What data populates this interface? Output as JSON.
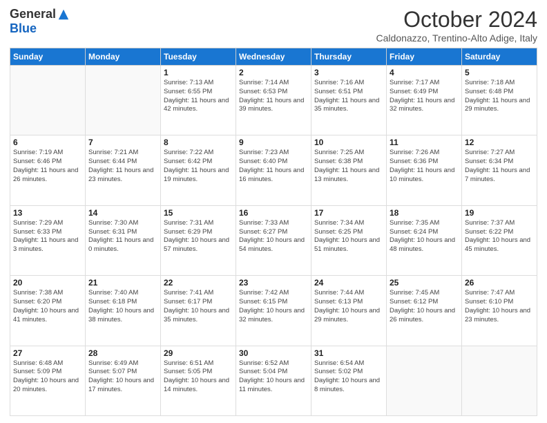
{
  "header": {
    "logo_general": "General",
    "logo_blue": "Blue",
    "month_title": "October 2024",
    "subtitle": "Caldonazzo, Trentino-Alto Adige, Italy"
  },
  "weekdays": [
    "Sunday",
    "Monday",
    "Tuesday",
    "Wednesday",
    "Thursday",
    "Friday",
    "Saturday"
  ],
  "weeks": [
    [
      {
        "day": "",
        "info": ""
      },
      {
        "day": "",
        "info": ""
      },
      {
        "day": "1",
        "info": "Sunrise: 7:13 AM\nSunset: 6:55 PM\nDaylight: 11 hours and 42 minutes."
      },
      {
        "day": "2",
        "info": "Sunrise: 7:14 AM\nSunset: 6:53 PM\nDaylight: 11 hours and 39 minutes."
      },
      {
        "day": "3",
        "info": "Sunrise: 7:16 AM\nSunset: 6:51 PM\nDaylight: 11 hours and 35 minutes."
      },
      {
        "day": "4",
        "info": "Sunrise: 7:17 AM\nSunset: 6:49 PM\nDaylight: 11 hours and 32 minutes."
      },
      {
        "day": "5",
        "info": "Sunrise: 7:18 AM\nSunset: 6:48 PM\nDaylight: 11 hours and 29 minutes."
      }
    ],
    [
      {
        "day": "6",
        "info": "Sunrise: 7:19 AM\nSunset: 6:46 PM\nDaylight: 11 hours and 26 minutes."
      },
      {
        "day": "7",
        "info": "Sunrise: 7:21 AM\nSunset: 6:44 PM\nDaylight: 11 hours and 23 minutes."
      },
      {
        "day": "8",
        "info": "Sunrise: 7:22 AM\nSunset: 6:42 PM\nDaylight: 11 hours and 19 minutes."
      },
      {
        "day": "9",
        "info": "Sunrise: 7:23 AM\nSunset: 6:40 PM\nDaylight: 11 hours and 16 minutes."
      },
      {
        "day": "10",
        "info": "Sunrise: 7:25 AM\nSunset: 6:38 PM\nDaylight: 11 hours and 13 minutes."
      },
      {
        "day": "11",
        "info": "Sunrise: 7:26 AM\nSunset: 6:36 PM\nDaylight: 11 hours and 10 minutes."
      },
      {
        "day": "12",
        "info": "Sunrise: 7:27 AM\nSunset: 6:34 PM\nDaylight: 11 hours and 7 minutes."
      }
    ],
    [
      {
        "day": "13",
        "info": "Sunrise: 7:29 AM\nSunset: 6:33 PM\nDaylight: 11 hours and 3 minutes."
      },
      {
        "day": "14",
        "info": "Sunrise: 7:30 AM\nSunset: 6:31 PM\nDaylight: 11 hours and 0 minutes."
      },
      {
        "day": "15",
        "info": "Sunrise: 7:31 AM\nSunset: 6:29 PM\nDaylight: 10 hours and 57 minutes."
      },
      {
        "day": "16",
        "info": "Sunrise: 7:33 AM\nSunset: 6:27 PM\nDaylight: 10 hours and 54 minutes."
      },
      {
        "day": "17",
        "info": "Sunrise: 7:34 AM\nSunset: 6:25 PM\nDaylight: 10 hours and 51 minutes."
      },
      {
        "day": "18",
        "info": "Sunrise: 7:35 AM\nSunset: 6:24 PM\nDaylight: 10 hours and 48 minutes."
      },
      {
        "day": "19",
        "info": "Sunrise: 7:37 AM\nSunset: 6:22 PM\nDaylight: 10 hours and 45 minutes."
      }
    ],
    [
      {
        "day": "20",
        "info": "Sunrise: 7:38 AM\nSunset: 6:20 PM\nDaylight: 10 hours and 41 minutes."
      },
      {
        "day": "21",
        "info": "Sunrise: 7:40 AM\nSunset: 6:18 PM\nDaylight: 10 hours and 38 minutes."
      },
      {
        "day": "22",
        "info": "Sunrise: 7:41 AM\nSunset: 6:17 PM\nDaylight: 10 hours and 35 minutes."
      },
      {
        "day": "23",
        "info": "Sunrise: 7:42 AM\nSunset: 6:15 PM\nDaylight: 10 hours and 32 minutes."
      },
      {
        "day": "24",
        "info": "Sunrise: 7:44 AM\nSunset: 6:13 PM\nDaylight: 10 hours and 29 minutes."
      },
      {
        "day": "25",
        "info": "Sunrise: 7:45 AM\nSunset: 6:12 PM\nDaylight: 10 hours and 26 minutes."
      },
      {
        "day": "26",
        "info": "Sunrise: 7:47 AM\nSunset: 6:10 PM\nDaylight: 10 hours and 23 minutes."
      }
    ],
    [
      {
        "day": "27",
        "info": "Sunrise: 6:48 AM\nSunset: 5:09 PM\nDaylight: 10 hours and 20 minutes."
      },
      {
        "day": "28",
        "info": "Sunrise: 6:49 AM\nSunset: 5:07 PM\nDaylight: 10 hours and 17 minutes."
      },
      {
        "day": "29",
        "info": "Sunrise: 6:51 AM\nSunset: 5:05 PM\nDaylight: 10 hours and 14 minutes."
      },
      {
        "day": "30",
        "info": "Sunrise: 6:52 AM\nSunset: 5:04 PM\nDaylight: 10 hours and 11 minutes."
      },
      {
        "day": "31",
        "info": "Sunrise: 6:54 AM\nSunset: 5:02 PM\nDaylight: 10 hours and 8 minutes."
      },
      {
        "day": "",
        "info": ""
      },
      {
        "day": "",
        "info": ""
      }
    ]
  ]
}
